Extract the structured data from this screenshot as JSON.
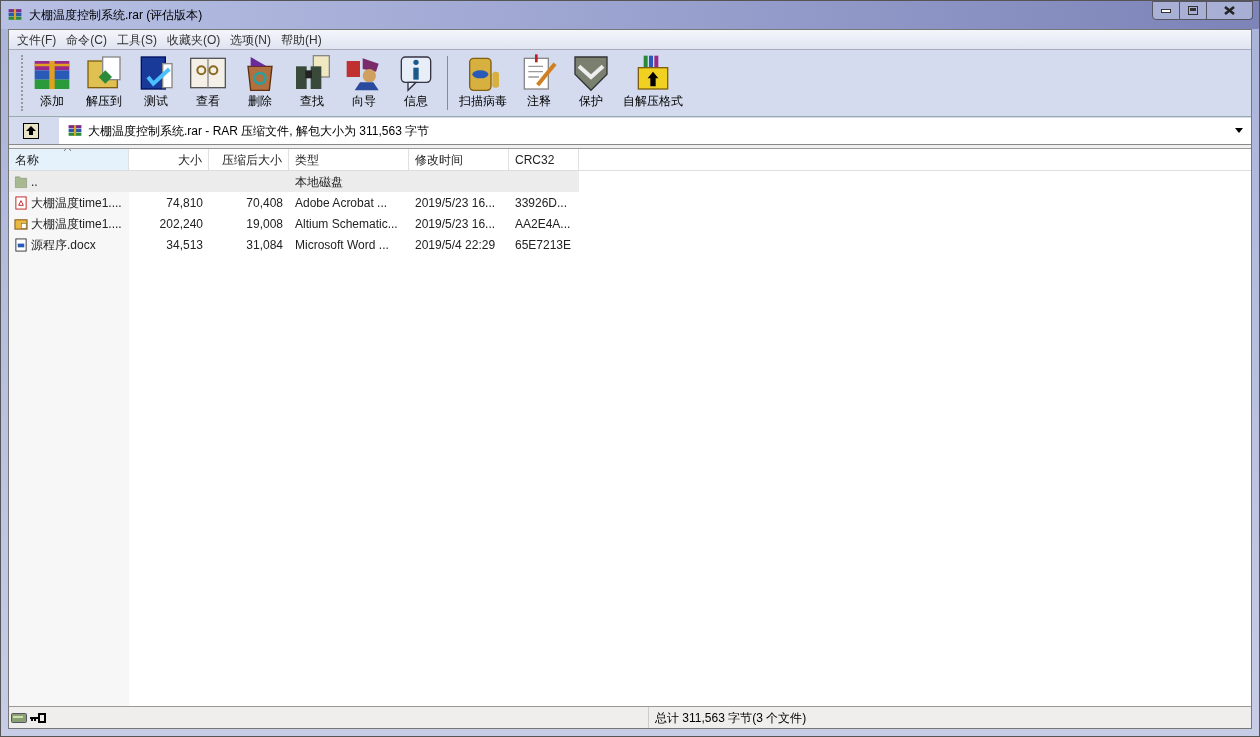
{
  "window": {
    "title": "大棚温度控制系统.rar (评估版本)"
  },
  "menu": [
    "文件(F)",
    "命令(C)",
    "工具(S)",
    "收藏夹(O)",
    "选项(N)",
    "帮助(H)"
  ],
  "toolbar": [
    {
      "kind": "add",
      "label": "添加"
    },
    {
      "kind": "extract",
      "label": "解压到"
    },
    {
      "kind": "test",
      "label": "测试"
    },
    {
      "kind": "view",
      "label": "查看"
    },
    {
      "kind": "delete",
      "label": "删除"
    },
    {
      "kind": "find",
      "label": "查找"
    },
    {
      "kind": "wizard",
      "label": "向导"
    },
    {
      "kind": "info",
      "label": "信息"
    },
    {
      "kind": "scan",
      "label": "扫描病毒"
    },
    {
      "kind": "comment",
      "label": "注释"
    },
    {
      "kind": "protect",
      "label": "保护"
    },
    {
      "kind": "sfx",
      "label": "自解压格式"
    }
  ],
  "address": {
    "text": "大棚温度控制系统.rar - RAR 压缩文件, 解包大小为 311,563 字节"
  },
  "table": {
    "columns": [
      {
        "label": "名称",
        "sorted": true
      },
      {
        "label": "大小",
        "sorted": false
      },
      {
        "label": "压缩后大小",
        "sorted": false
      },
      {
        "label": "类型",
        "sorted": false
      },
      {
        "label": "修改时间",
        "sorted": false
      },
      {
        "label": "CRC32",
        "sorted": false
      }
    ],
    "rows": [
      {
        "kind": "folder",
        "selected": true,
        "cells": [
          "..",
          "",
          "",
          "本地磁盘",
          "",
          ""
        ]
      },
      {
        "kind": "pdf",
        "selected": false,
        "cells": [
          "大棚温度time1....",
          "74,810",
          "70,408",
          "Adobe Acrobat ...",
          "2019/5/23 16...",
          "33926D..."
        ]
      },
      {
        "kind": "schematic",
        "selected": false,
        "cells": [
          "大棚温度time1....",
          "202,240",
          "19,008",
          "Altium Schematic...",
          "2019/5/23 16...",
          "AA2E4A..."
        ]
      },
      {
        "kind": "doc",
        "selected": false,
        "cells": [
          "源程序.docx",
          "34,513",
          "31,084",
          "Microsoft Word ...",
          "2019/5/4 22:29",
          "65E7213E"
        ]
      }
    ]
  },
  "status_bar": {
    "text": "总计 311,563 字节(3 个文件)"
  }
}
